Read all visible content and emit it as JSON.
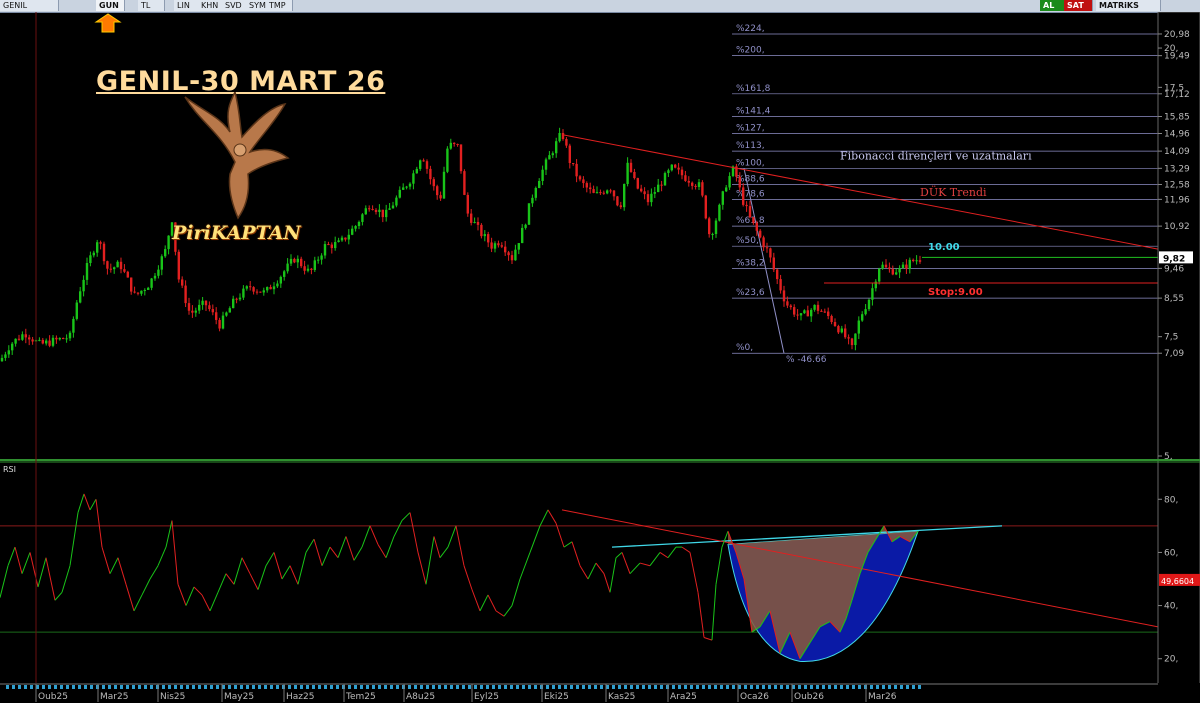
{
  "toolbar": {
    "symbol": "GENIL",
    "items": [
      "GUN",
      "TL",
      "LIN",
      "KHN",
      "SVD",
      "SYM",
      "TMP"
    ],
    "buy": "AL",
    "sell": "SAT",
    "brand": "MATRiKS"
  },
  "logo": {
    "title": "GENIL-30 MART 26",
    "brand": "PiriKAPTAN"
  },
  "chart_data": [
    {
      "type": "candlestick",
      "title": "",
      "yscale": "log",
      "ylim": [
        5,
        22
      ],
      "y_ticks": [
        "20,98",
        "20,",
        "19,49",
        "17,5",
        "17,12",
        "15,85",
        "14,96",
        "14,09",
        "13,29",
        "12,58",
        "11,96",
        "10,92",
        "9,46",
        "8,55",
        "7,5",
        "7,09",
        "5,"
      ],
      "y_tick_values": [
        20.98,
        20,
        19.49,
        17.5,
        17.12,
        15.85,
        14.96,
        14.09,
        13.29,
        12.58,
        11.96,
        10.92,
        9.46,
        8.55,
        7.5,
        7.09,
        5
      ],
      "x_ticks": [
        "Oub25",
        "Mar25",
        "Nis25",
        "May25",
        "Haz25",
        "Tem25",
        "A8u25",
        "Eyl25",
        "Eki25",
        "Kas25",
        "Ara25",
        "Oca26",
        "Oub26",
        "Mar26"
      ],
      "price_path": [
        [
          0,
          6.9
        ],
        [
          10,
          7.3
        ],
        [
          25,
          7.6
        ],
        [
          40,
          7.3
        ],
        [
          55,
          7.4
        ],
        [
          70,
          7.5
        ],
        [
          78,
          8.6
        ],
        [
          88,
          9.6
        ],
        [
          98,
          10.5
        ],
        [
          108,
          9.4
        ],
        [
          120,
          9.6
        ],
        [
          135,
          8.6
        ],
        [
          150,
          9.0
        ],
        [
          165,
          10.0
        ],
        [
          172,
          11.2
        ],
        [
          178,
          9.2
        ],
        [
          190,
          8.1
        ],
        [
          205,
          8.4
        ],
        [
          220,
          7.8
        ],
        [
          235,
          8.5
        ],
        [
          250,
          8.9
        ],
        [
          265,
          8.7
        ],
        [
          280,
          9.2
        ],
        [
          295,
          9.8
        ],
        [
          310,
          9.3
        ],
        [
          325,
          10.2
        ],
        [
          340,
          10.3
        ],
        [
          355,
          10.9
        ],
        [
          370,
          11.8
        ],
        [
          385,
          11.3
        ],
        [
          400,
          12.2
        ],
        [
          412,
          12.9
        ],
        [
          422,
          14.0
        ],
        [
          432,
          12.6
        ],
        [
          440,
          11.9
        ],
        [
          448,
          14.4
        ],
        [
          458,
          14.3
        ],
        [
          466,
          11.5
        ],
        [
          480,
          10.7
        ],
        [
          492,
          10.2
        ],
        [
          500,
          10.4
        ],
        [
          512,
          9.8
        ],
        [
          524,
          10.9
        ],
        [
          535,
          12.5
        ],
        [
          548,
          13.7
        ],
        [
          562,
          15.0
        ],
        [
          570,
          13.6
        ],
        [
          580,
          12.7
        ],
        [
          595,
          12.1
        ],
        [
          610,
          12.5
        ],
        [
          620,
          11.6
        ],
        [
          628,
          13.5
        ],
        [
          636,
          12.5
        ],
        [
          648,
          11.9
        ],
        [
          660,
          12.6
        ],
        [
          672,
          13.3
        ],
        [
          685,
          12.9
        ],
        [
          700,
          12.5
        ],
        [
          710,
          10.5
        ],
        [
          718,
          11.4
        ],
        [
          726,
          12.6
        ],
        [
          734,
          13.3
        ],
        [
          742,
          12.0
        ],
        [
          750,
          11.2
        ],
        [
          760,
          10.5
        ],
        [
          768,
          10.0
        ],
        [
          776,
          9.2
        ],
        [
          786,
          8.4
        ],
        [
          800,
          8.0
        ],
        [
          815,
          8.3
        ],
        [
          830,
          8.0
        ],
        [
          845,
          7.5
        ],
        [
          852,
          7.2
        ],
        [
          860,
          8.0
        ],
        [
          870,
          8.6
        ],
        [
          880,
          9.6
        ],
        [
          888,
          9.4
        ],
        [
          900,
          9.4
        ],
        [
          912,
          9.7
        ],
        [
          922,
          9.8
        ]
      ],
      "fibonacci": {
        "title": "Fibonacci dirençleri ve uzatmaları",
        "levels": [
          {
            "label": "%224,",
            "price": 20.98
          },
          {
            "label": "%200,",
            "price": 19.49
          },
          {
            "label": "%161,8",
            "price": 17.12
          },
          {
            "label": "%141,4",
            "price": 15.85
          },
          {
            "label": "%127,",
            "price": 14.96
          },
          {
            "label": "%113,",
            "price": 14.09
          },
          {
            "label": "%100,",
            "price": 13.29
          },
          {
            "label": "%88,6",
            "price": 12.58
          },
          {
            "label": "%78,6",
            "price": 11.96
          },
          {
            "label": "%61,8",
            "price": 10.92
          },
          {
            "label": "%50,",
            "price": 10.2
          },
          {
            "label": "%38,2",
            "price": 9.46
          },
          {
            "label": "%23,6",
            "price": 8.55
          },
          {
            "label": "%0,",
            "price": 7.09
          }
        ],
        "drop_label": "% -46.66"
      },
      "annotations": {
        "trend_label": "DÜK Trendi",
        "target_label": "10.00",
        "target_price": 10.0,
        "stop_label": "Stop:9.00",
        "stop_price": 9.0,
        "last_price_label": "9,82",
        "last_price": 9.82
      }
    },
    {
      "type": "line",
      "title": "RSI",
      "ylim": [
        12,
        88
      ],
      "y_ticks": [
        "80,",
        "60,",
        "40,",
        "20,"
      ],
      "y_tick_values": [
        80,
        60,
        40,
        20
      ],
      "last_value_label": "49,6604",
      "last_value": 49.66,
      "levels": [
        70,
        30
      ],
      "rsi_path": [
        [
          0,
          43
        ],
        [
          8,
          55
        ],
        [
          15,
          62
        ],
        [
          22,
          52
        ],
        [
          30,
          60
        ],
        [
          38,
          47
        ],
        [
          46,
          58
        ],
        [
          55,
          42
        ],
        [
          62,
          45
        ],
        [
          70,
          55
        ],
        [
          78,
          75
        ],
        [
          84,
          82
        ],
        [
          90,
          76
        ],
        [
          96,
          80
        ],
        [
          102,
          62
        ],
        [
          110,
          52
        ],
        [
          118,
          58
        ],
        [
          126,
          48
        ],
        [
          134,
          38
        ],
        [
          142,
          44
        ],
        [
          150,
          50
        ],
        [
          158,
          55
        ],
        [
          166,
          62
        ],
        [
          172,
          72
        ],
        [
          178,
          48
        ],
        [
          186,
          40
        ],
        [
          194,
          47
        ],
        [
          202,
          44
        ],
        [
          210,
          38
        ],
        [
          218,
          45
        ],
        [
          226,
          52
        ],
        [
          234,
          48
        ],
        [
          242,
          58
        ],
        [
          250,
          52
        ],
        [
          258,
          46
        ],
        [
          266,
          55
        ],
        [
          274,
          60
        ],
        [
          282,
          50
        ],
        [
          290,
          55
        ],
        [
          298,
          48
        ],
        [
          306,
          60
        ],
        [
          314,
          65
        ],
        [
          322,
          55
        ],
        [
          330,
          62
        ],
        [
          338,
          58
        ],
        [
          346,
          66
        ],
        [
          354,
          57
        ],
        [
          362,
          62
        ],
        [
          370,
          70
        ],
        [
          378,
          63
        ],
        [
          386,
          58
        ],
        [
          394,
          66
        ],
        [
          402,
          72
        ],
        [
          410,
          75
        ],
        [
          418,
          60
        ],
        [
          426,
          48
        ],
        [
          434,
          66
        ],
        [
          440,
          58
        ],
        [
          448,
          62
        ],
        [
          456,
          70
        ],
        [
          464,
          55
        ],
        [
          472,
          46
        ],
        [
          480,
          38
        ],
        [
          488,
          44
        ],
        [
          496,
          38
        ],
        [
          504,
          36
        ],
        [
          512,
          40
        ],
        [
          520,
          50
        ],
        [
          530,
          60
        ],
        [
          540,
          70
        ],
        [
          548,
          76
        ],
        [
          556,
          71
        ],
        [
          564,
          62
        ],
        [
          572,
          64
        ],
        [
          580,
          55
        ],
        [
          588,
          50
        ],
        [
          596,
          56
        ],
        [
          604,
          52
        ],
        [
          610,
          45
        ],
        [
          616,
          58
        ],
        [
          622,
          60
        ],
        [
          630,
          52
        ],
        [
          640,
          56
        ],
        [
          650,
          55
        ],
        [
          660,
          60
        ],
        [
          668,
          58
        ],
        [
          676,
          62
        ],
        [
          682,
          62
        ],
        [
          690,
          60
        ],
        [
          698,
          45
        ],
        [
          704,
          28
        ],
        [
          712,
          27
        ],
        [
          716,
          48
        ],
        [
          722,
          62
        ],
        [
          728,
          68
        ],
        [
          736,
          60
        ],
        [
          744,
          50
        ],
        [
          752,
          30
        ],
        [
          760,
          32
        ],
        [
          770,
          38
        ],
        [
          780,
          22
        ],
        [
          790,
          30
        ],
        [
          800,
          20
        ],
        [
          810,
          26
        ],
        [
          820,
          32
        ],
        [
          830,
          34
        ],
        [
          840,
          30
        ],
        [
          846,
          35
        ],
        [
          852,
          42
        ],
        [
          860,
          52
        ],
        [
          868,
          60
        ],
        [
          876,
          65
        ],
        [
          884,
          70
        ],
        [
          892,
          64
        ],
        [
          900,
          66
        ],
        [
          910,
          64
        ],
        [
          918,
          68
        ]
      ],
      "arc_upper_start": [
        728,
        63
      ],
      "arc_bottom": [
        800,
        19
      ],
      "arc_upper_end": [
        918,
        68
      ]
    }
  ],
  "colors": {
    "up": "#19c419",
    "down": "#e22020",
    "grid": "#3c3c3c",
    "fib": "#9090c8",
    "trend": "#e02020",
    "cyan": "#40d8e8",
    "green_line": "#20c020",
    "axis_text": "#bbbbbb",
    "arc_fill_blue": "#0a1aa6",
    "arc_fill_brown": "#8a5a3a"
  }
}
